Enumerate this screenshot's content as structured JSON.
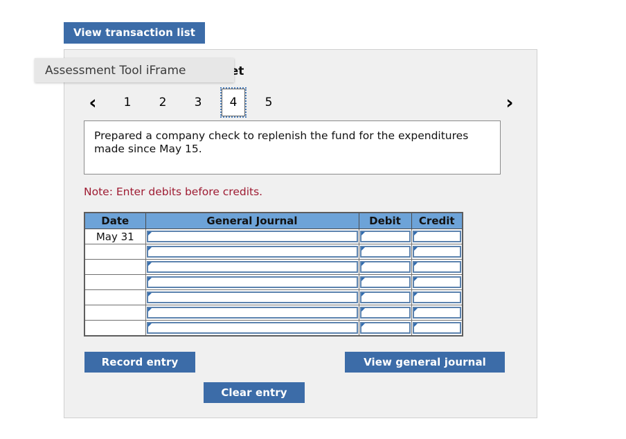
{
  "top_actions": {
    "view_transaction_list_label": "View transaction list"
  },
  "tooltip": {
    "text": "Assessment Tool iFrame"
  },
  "panel": {
    "title": "Journal entry worksheet"
  },
  "pager": {
    "prev_icon": "chevron-left-icon",
    "prev_glyph": "‹",
    "next_icon": "chevron-right-icon",
    "next_glyph": "›",
    "pages": [
      "1",
      "2",
      "3",
      "4",
      "5"
    ],
    "active_page": "4"
  },
  "description": {
    "text": "Prepared a company check to replenish the fund for the expenditures made since May 15."
  },
  "note": {
    "text": "Note: Enter debits before credits.",
    "color": "#9e1b32"
  },
  "journal": {
    "columns": [
      "Date",
      "General Journal",
      "Debit",
      "Credit"
    ],
    "rows": [
      {
        "date": "May 31",
        "general_journal": "",
        "debit": "",
        "credit": ""
      },
      {
        "date": "",
        "general_journal": "",
        "debit": "",
        "credit": ""
      },
      {
        "date": "",
        "general_journal": "",
        "debit": "",
        "credit": ""
      },
      {
        "date": "",
        "general_journal": "",
        "debit": "",
        "credit": ""
      },
      {
        "date": "",
        "general_journal": "",
        "debit": "",
        "credit": ""
      },
      {
        "date": "",
        "general_journal": "",
        "debit": "",
        "credit": ""
      },
      {
        "date": "",
        "general_journal": "",
        "debit": "",
        "credit": ""
      }
    ],
    "header_color": "#6da3d8"
  },
  "buttons": {
    "record_entry_label": "Record entry",
    "clear_entry_label": "Clear entry",
    "view_general_journal_label": "View general journal",
    "color": "#3c6ca8"
  }
}
